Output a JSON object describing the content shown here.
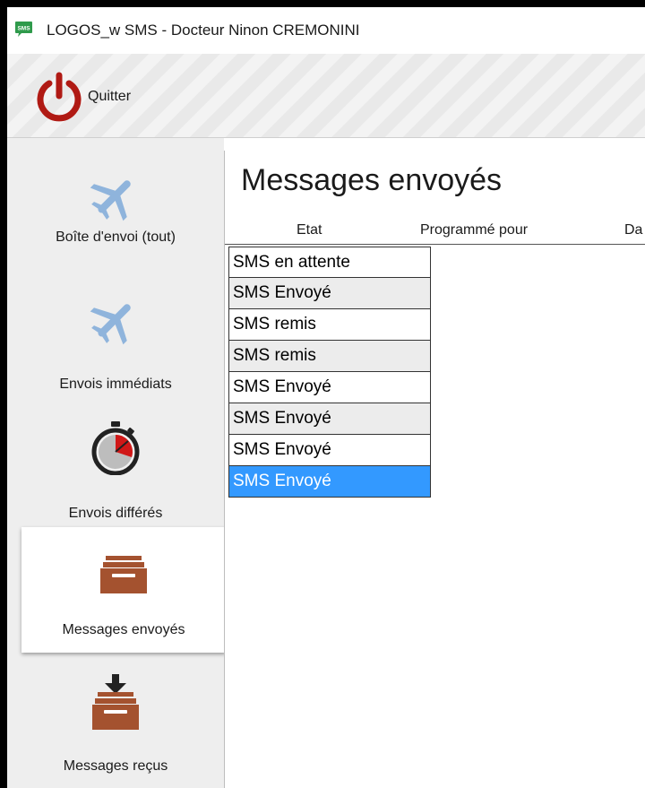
{
  "window": {
    "title": "LOGOS_w  SMS - Docteur Ninon CREMONINI",
    "app_icon_text": "SMS"
  },
  "toolbar": {
    "quit_label": "Quitter"
  },
  "sidebar": {
    "items": [
      {
        "label": "Boîte d'envoi (tout)",
        "icon": "airplane-icon",
        "active": false
      },
      {
        "label": "Envois immédiats",
        "icon": "airplane-icon",
        "active": false
      },
      {
        "label": "Envois différés",
        "icon": "stopwatch-icon",
        "active": false
      },
      {
        "label": "Messages envoyés",
        "icon": "outbox-tray-icon",
        "active": true
      },
      {
        "label": "Messages reçus",
        "icon": "inbox-tray-icon",
        "active": false
      }
    ]
  },
  "main": {
    "title": "Messages envoyés",
    "columns": [
      "Etat",
      "Programmé pour",
      "Da"
    ],
    "rows": [
      {
        "etat": "SMS en attente"
      },
      {
        "etat": "SMS Envoyé"
      },
      {
        "etat": "SMS remis"
      },
      {
        "etat": "SMS remis"
      },
      {
        "etat": "SMS Envoyé"
      },
      {
        "etat": "SMS Envoyé"
      },
      {
        "etat": "SMS Envoyé"
      },
      {
        "etat": "SMS Envoyé",
        "selected": true
      }
    ]
  },
  "colors": {
    "power_red": "#b01a14",
    "tray_brown": "#a4522f",
    "airplane_blue": "#8fb4dc",
    "selection_blue": "#3399ff",
    "app_icon_green": "#2f9a4b"
  }
}
